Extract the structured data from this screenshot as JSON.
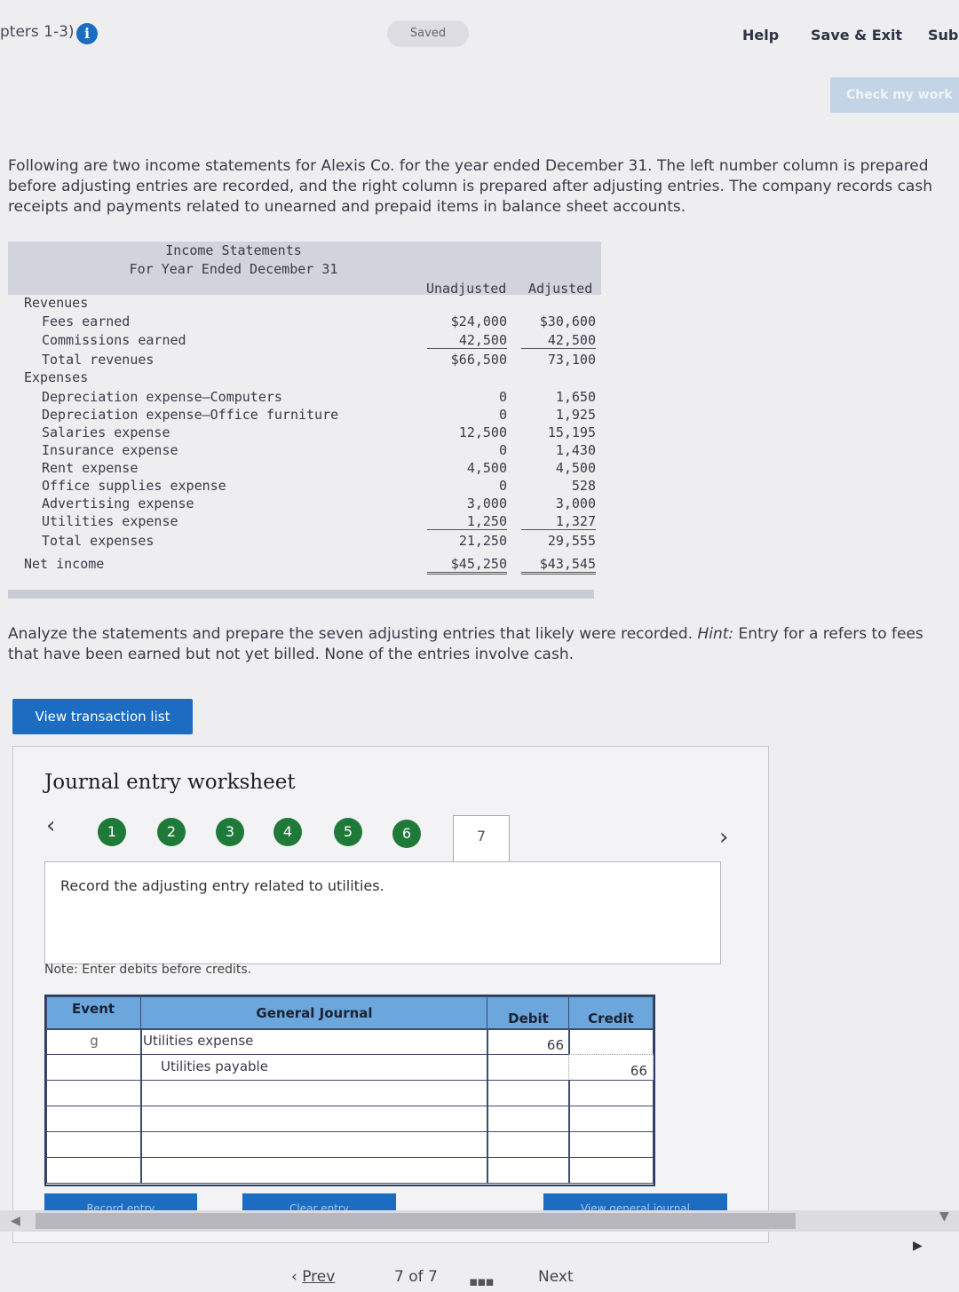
{
  "header": {
    "chapter": "pters 1-3)",
    "saved": "Saved",
    "help": "Help",
    "save_exit": "Save & Exit",
    "submit": "Sub",
    "check": "Check my work"
  },
  "intro": "Following are two income statements for Alexis Co. for the year ended December 31. The left number column is prepared before adjusting entries are recorded, and the right column is prepared after adjusting entries. The company records cash receipts and payments related to unearned and prepaid items in balance sheet accounts.",
  "statement": {
    "title": "Income Statements",
    "subtitle": "For Year Ended December 31",
    "col_unadj": "Unadjusted",
    "col_adj": "Adjusted",
    "revenues_label": "Revenues",
    "expenses_label": "Expenses",
    "revenues": [
      {
        "label": "Fees earned",
        "unadj": "$24,000",
        "adj": "$30,600"
      },
      {
        "label": "Commissions earned",
        "unadj": "42,500",
        "adj": "42,500"
      },
      {
        "label": "Total revenues",
        "unadj": "$66,500",
        "adj": "73,100"
      }
    ],
    "expenses": [
      {
        "label": "Depreciation expense—Computers",
        "unadj": "0",
        "adj": "1,650"
      },
      {
        "label": "Depreciation expense—Office furniture",
        "unadj": "0",
        "adj": "1,925"
      },
      {
        "label": "Salaries expense",
        "unadj": "12,500",
        "adj": "15,195"
      },
      {
        "label": "Insurance expense",
        "unadj": "0",
        "adj": "1,430"
      },
      {
        "label": "Rent expense",
        "unadj": "4,500",
        "adj": "4,500"
      },
      {
        "label": "Office supplies expense",
        "unadj": "0",
        "adj": "528"
      },
      {
        "label": "Advertising expense",
        "unadj": "3,000",
        "adj": "3,000"
      },
      {
        "label": "Utilities expense",
        "unadj": "1,250",
        "adj": "1,327"
      },
      {
        "label": "Total expenses",
        "unadj": "21,250",
        "adj": "29,555"
      }
    ],
    "net_income": {
      "label": "Net income",
      "unadj": "$45,250",
      "adj": "$43,545"
    }
  },
  "instructions_main": "Analyze the statements and prepare the seven adjusting entries that likely were recorded.",
  "hint_label": "Hint:",
  "hint_text": "Entry for a refers to fees that have been earned but not yet billed. None of the entries involve cash.",
  "view_button": "View transaction list",
  "worksheet": {
    "title": "Journal entry worksheet",
    "steps": [
      "1",
      "2",
      "3",
      "4",
      "5",
      "6",
      "7"
    ],
    "prompt": "Record the adjusting entry related to utilities.",
    "note": "Note: Enter debits before credits.",
    "headers": {
      "event": "Event",
      "journal": "General Journal",
      "debit": "Debit",
      "credit": "Credit"
    },
    "rows": [
      {
        "event": "g",
        "account": "Utilities expense",
        "debit": "66",
        "credit": ""
      },
      {
        "event": "",
        "account": "Utilities payable",
        "debit": "",
        "credit": "66"
      },
      {
        "event": "",
        "account": "",
        "debit": "",
        "credit": ""
      },
      {
        "event": "",
        "account": "",
        "debit": "",
        "credit": ""
      },
      {
        "event": "",
        "account": "",
        "debit": "",
        "credit": ""
      },
      {
        "event": "",
        "account": "",
        "debit": "",
        "credit": ""
      }
    ],
    "btn_record": "Record entry",
    "btn_clear": "Clear entry",
    "btn_view": "View general journal"
  },
  "footer": {
    "prev": "Prev",
    "page": "7 of 7",
    "next": "Next"
  }
}
